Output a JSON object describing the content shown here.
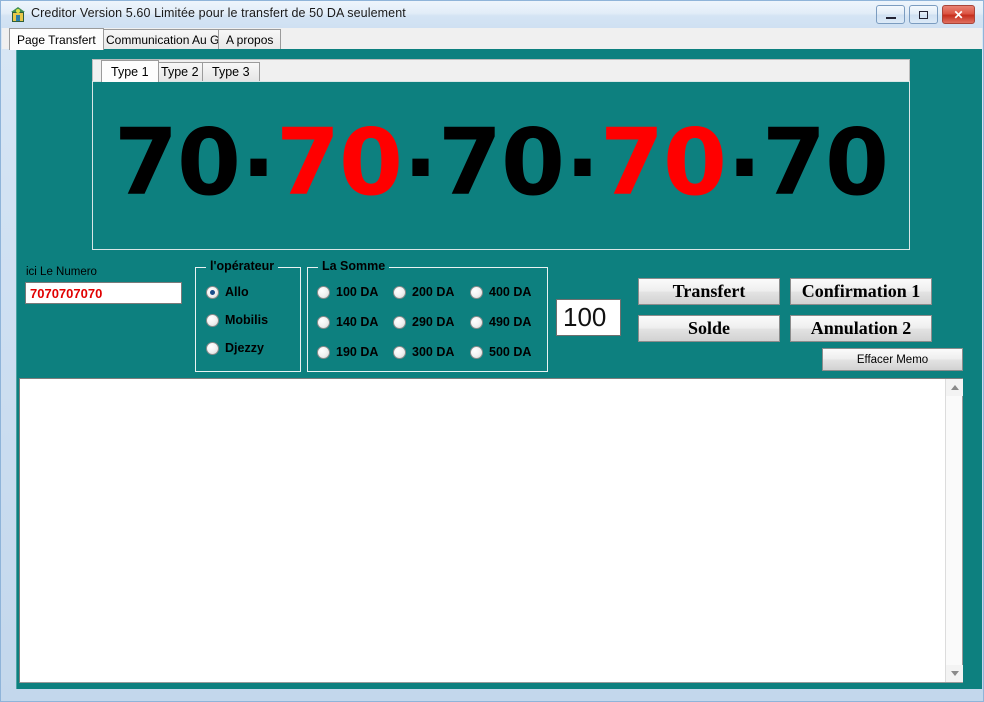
{
  "window": {
    "title": "Creditor  Version 5.60  Limitée pour le transfert de 50 DA seulement",
    "icon": "app-icon",
    "controls": {
      "minimize": "minimize-icon",
      "maximize": "maximize-icon",
      "close": "✕"
    }
  },
  "main_tabs": [
    {
      "label": "Page Transfert",
      "active": true
    },
    {
      "label": "Communication Au GSM",
      "active": false
    },
    {
      "label": "A propos",
      "active": false
    }
  ],
  "type_tabs": [
    {
      "label": "Type 1",
      "active": true
    },
    {
      "label": "Type 2",
      "active": false
    },
    {
      "label": "Type 3",
      "active": false
    }
  ],
  "display": {
    "groups": [
      "70",
      "70",
      "70",
      "70",
      "70"
    ],
    "separator": "·",
    "colors": [
      "#000000",
      "#ff0000",
      "#000000",
      "#ff0000",
      "#000000"
    ],
    "full_text": "70·70·70·70·70"
  },
  "numero": {
    "label": "ici Le Numero",
    "value": "7070707070",
    "placeholder": "",
    "color": "#e00000"
  },
  "operateur": {
    "title": "l'opérateur",
    "options": [
      {
        "label": "Allo",
        "checked": true
      },
      {
        "label": "Mobilis",
        "checked": false
      },
      {
        "label": "Djezzy",
        "checked": false
      }
    ]
  },
  "somme": {
    "title": "La Somme",
    "options": [
      {
        "label": "100 DA",
        "checked": false
      },
      {
        "label": "200 DA",
        "checked": false
      },
      {
        "label": "400 DA",
        "checked": false
      },
      {
        "label": "140 DA",
        "checked": false
      },
      {
        "label": "290 DA",
        "checked": false
      },
      {
        "label": "490 DA",
        "checked": false
      },
      {
        "label": "190 DA",
        "checked": false
      },
      {
        "label": "300 DA",
        "checked": false
      },
      {
        "label": "500 DA",
        "checked": false
      }
    ]
  },
  "amount": {
    "value": "100",
    "placeholder": ""
  },
  "buttons": {
    "transfert": "Transfert",
    "confirmation": "Confirmation 1",
    "solde": "Solde",
    "annulation": "Annulation  2",
    "effacer_memo": "Effacer Memo"
  },
  "memo": {
    "value": "",
    "placeholder": ""
  },
  "theme": {
    "page_background": "#0d807f",
    "accent_red": "#ff0000",
    "text_black": "#000000"
  }
}
